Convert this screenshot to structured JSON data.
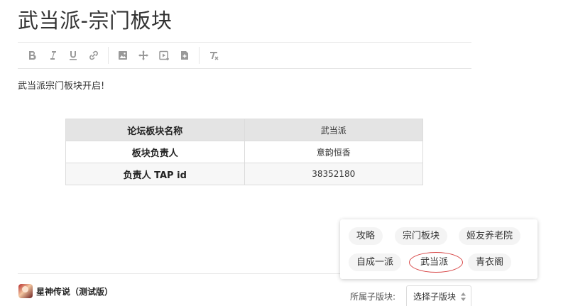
{
  "page": {
    "title": "武当派-宗门板块",
    "intro": "武当派宗门板块开启!"
  },
  "toolbar": {
    "groups": [
      [
        "bold-icon",
        "italic-icon",
        "underline-icon",
        "link-icon"
      ],
      [
        "image-icon",
        "move-icon",
        "video-icon",
        "add-file-icon"
      ],
      [
        "clear-format-icon"
      ]
    ],
    "icon_color": "#999999"
  },
  "table": {
    "rows": [
      {
        "key": "论坛板块名称",
        "value": "武当派"
      },
      {
        "key": "板块负责人",
        "value": "意韵恒香"
      },
      {
        "key": "负责人 TAP id",
        "value": "38352180"
      }
    ]
  },
  "game": {
    "name": "星神传说（测试版）"
  },
  "subsection": {
    "label": "所属子版块:",
    "select_placeholder": "选择子版块",
    "options": [
      "攻略",
      "宗门板块",
      "姬友养老院",
      "自成一派",
      "武当派",
      "青衣阁"
    ],
    "selected": "武当派",
    "highlight_color": "#d84848"
  }
}
